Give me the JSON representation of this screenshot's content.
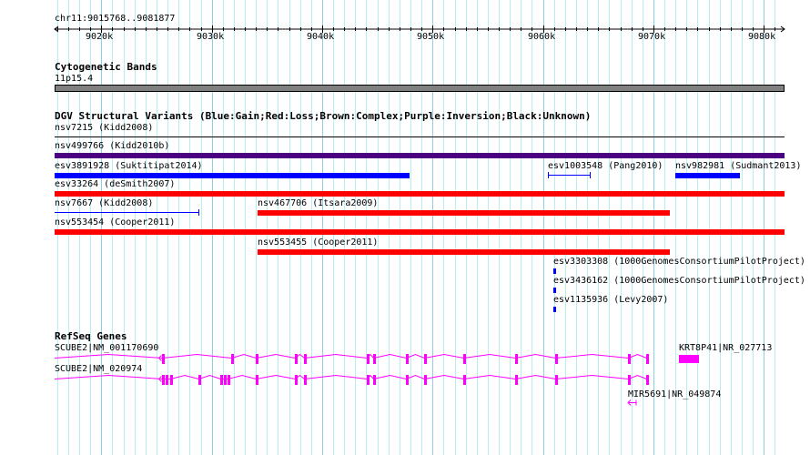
{
  "ruler": {
    "label": "chr11:9015768..9081877",
    "start_kb": 9015.768,
    "end_kb": 9081.877,
    "ticks": [
      "9020k",
      "9030k",
      "9040k",
      "9050k",
      "9060k",
      "9070k",
      "9080k"
    ]
  },
  "cytoband": {
    "title": "Cytogenetic Bands",
    "band": "11p15.4",
    "color": "#808080"
  },
  "dgv": {
    "title": "DGV Structural Variants (Blue:Gain;Red:Loss;Brown:Complex;Purple:Inversion;Black:Unknown)",
    "features": [
      {
        "label": "nsv7215 (Kidd2008)",
        "start": 9015.768,
        "end": 9081.877,
        "color": "#000000",
        "style": "line",
        "row": 0
      },
      {
        "label": "nsv499766 (Kidd2010b)",
        "start": 9015.768,
        "end": 9081.877,
        "color": "#4b0082",
        "style": "bar",
        "row": 1
      },
      {
        "label": "esv3891928 (Suktitipat2014)",
        "start": 9015.768,
        "end": 9047.9,
        "color": "#0000ff",
        "style": "bar",
        "row": 2
      },
      {
        "label": "esv1003548 (Pang2010)",
        "start": 9060.45,
        "end": 9064.24,
        "color": "#0000ff",
        "style": "line",
        "row": 2
      },
      {
        "label": "nsv982981 (Sudmant2013)",
        "start": 9071.99,
        "end": 9077.85,
        "color": "#0000ff",
        "style": "bar",
        "row": 2
      },
      {
        "label": "esv33264 (deSmith2007)",
        "start": 9015.768,
        "end": 9081.877,
        "color": "#ff0000",
        "style": "bar",
        "row": 3
      },
      {
        "label": "nsv7667 (Kidd2008)",
        "start": 9015.768,
        "end": 9028.8,
        "color": "#0000ff",
        "style": "line",
        "row": 4
      },
      {
        "label": "nsv467706 (Itsara2009)",
        "start": 9034.15,
        "end": 9071.5,
        "color": "#ff0000",
        "style": "bar",
        "row": 4
      },
      {
        "label": "nsv553454 (Cooper2011)",
        "start": 9015.768,
        "end": 9081.877,
        "color": "#ff0000",
        "style": "bar",
        "row": 5
      },
      {
        "label": "nsv553455 (Cooper2011)",
        "start": 9034.15,
        "end": 9071.5,
        "color": "#ff0000",
        "style": "bar",
        "row": 6
      },
      {
        "label": "esv3303308 (1000GenomesConsortiumPilotProject)",
        "start": 9060.95,
        "end": 9061.2,
        "color": "#0000ff",
        "style": "bar",
        "row": 7
      },
      {
        "label": "esv3436162 (1000GenomesConsortiumPilotProject)",
        "start": 9060.95,
        "end": 9061.2,
        "color": "#0000ff",
        "style": "bar",
        "row": 8
      },
      {
        "label": "esv1135936 (Levy2007)",
        "start": 9060.95,
        "end": 9061.2,
        "color": "#0000ff",
        "style": "bar",
        "row": 9
      }
    ]
  },
  "refseq": {
    "title": "RefSeq Genes",
    "color": "#ff00ff",
    "genes": [
      {
        "label": "SCUBE2|NM_001170690",
        "start": 9015.768,
        "end": 9069.4,
        "strand": "-",
        "row": 0,
        "exons": [
          9025.5,
          9031.76,
          9033.99,
          9037.53,
          9038.36,
          9044.05,
          9044.62,
          9047.59,
          9049.24,
          9052.78,
          9057.48,
          9061.11,
          9067.71,
          9069.35
        ]
      },
      {
        "label": "SCUBE2|NM_020974",
        "start": 9015.768,
        "end": 9069.4,
        "strand": "-",
        "row": 1,
        "exons": [
          9025.5,
          9025.85,
          9026.2,
          9028.79,
          9030.77,
          9031.1,
          9031.43,
          9033.99,
          9037.53,
          9038.36,
          9044.05,
          9044.62,
          9047.59,
          9049.24,
          9052.78,
          9057.48,
          9061.11,
          9067.71,
          9069.35
        ]
      },
      {
        "label": "KRT8P41|NR_027713",
        "start": 9072.32,
        "end": 9074.13,
        "strand": "+",
        "row": 0,
        "box": true
      },
      {
        "label": "MIR5691|NR_049874",
        "start": 9067.7,
        "end": 9068.3,
        "strand": "-",
        "row": 2,
        "arrow": true
      }
    ]
  }
}
